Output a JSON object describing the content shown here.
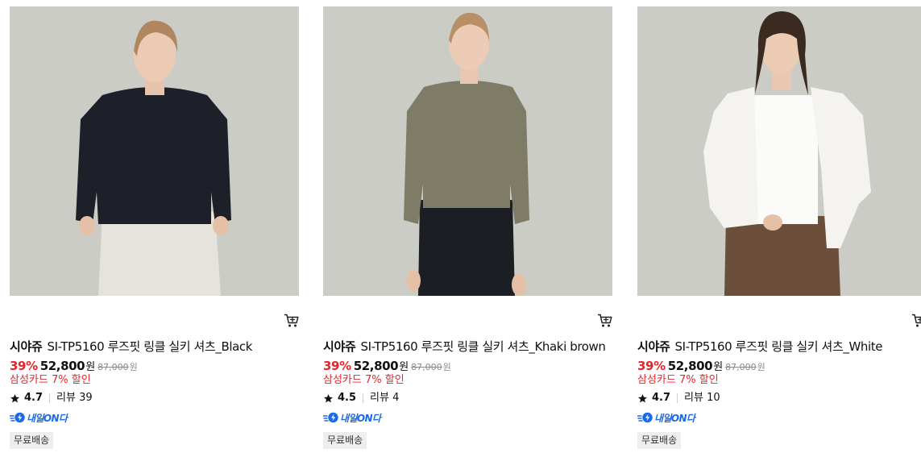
{
  "products": [
    {
      "brand": "시야쥬",
      "name": "SI-TP5160 루즈핏 링클 실키 셔츠_Black",
      "discount_rate": "39%",
      "price": "52,800",
      "currency": "원",
      "original_price": "87,000",
      "original_currency": "원",
      "card_promo": "삼성카드 7% 할인",
      "rating": "4.7",
      "review_label": "리뷰 39",
      "delivery_badge": "내일ON다",
      "shipping_badge": "무료배송",
      "image": {
        "shirt_color": "#1d2029",
        "bottom_color": "#e6e3dc",
        "hair_color": "#b08660",
        "model": "model-photo"
      }
    },
    {
      "brand": "시야쥬",
      "name": "SI-TP5160 루즈핏 링클 실키 셔츠_Khaki brown",
      "discount_rate": "39%",
      "price": "52,800",
      "currency": "원",
      "original_price": "87,000",
      "original_currency": "원",
      "card_promo": "삼성카드 7% 할인",
      "rating": "4.5",
      "review_label": "리뷰 4",
      "delivery_badge": "내일ON다",
      "shipping_badge": "무료배송",
      "image": {
        "shirt_color": "#7e7c66",
        "bottom_color": "#1b1e22",
        "hair_color": "#b89068",
        "model": "model-photo"
      }
    },
    {
      "brand": "시야쥬",
      "name": "SI-TP5160 루즈핏 링클 실키 셔츠_White",
      "discount_rate": "39%",
      "price": "52,800",
      "currency": "원",
      "original_price": "87,000",
      "original_currency": "원",
      "card_promo": "삼성카드 7% 할인",
      "rating": "4.7",
      "review_label": "리뷰 10",
      "delivery_badge": "내일ON다",
      "shipping_badge": "무료배송",
      "image": {
        "shirt_color": "#f4f3ef",
        "bottom_color": "#6b4f3a",
        "hair_color": "#3a2a20",
        "model": "model-photo"
      }
    }
  ],
  "colors": {
    "accent_red": "#e4262c",
    "delivery_blue": "#1a6ae5",
    "photo_bg": "#c9c8c4"
  },
  "icons": {
    "cart": "cart-icon",
    "star": "star-icon",
    "delivery": "lightning-icon"
  }
}
